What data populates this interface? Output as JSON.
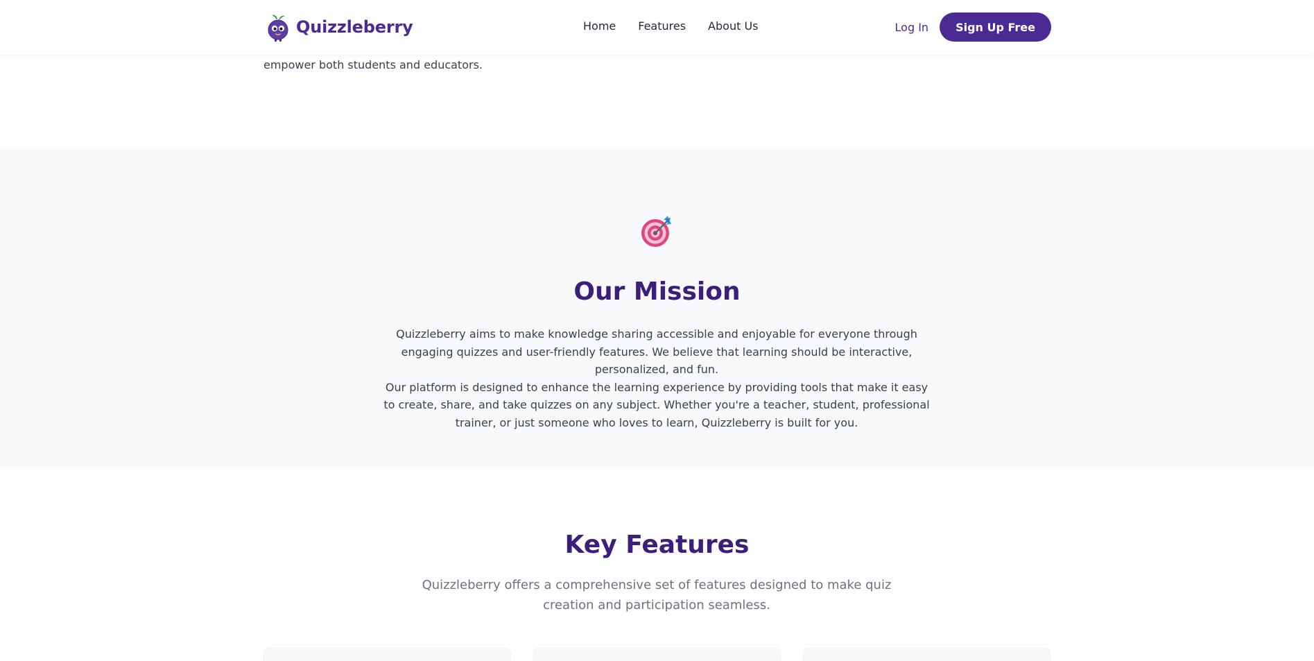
{
  "header": {
    "brand_name": "Quizzleberry",
    "nav": [
      "Home",
      "Features",
      "About Us"
    ],
    "login_label": "Log In",
    "signup_label": "Sign Up Free"
  },
  "intro": {
    "tail_line": "empower both students and educators."
  },
  "mission": {
    "icon": "target-dart-icon",
    "title": "Our Mission",
    "paragraph_1": "Quizzleberry aims to make knowledge sharing accessible and enjoyable for everyone through engaging quizzes and user-friendly features. We believe that learning should be interactive, personalized, and fun.",
    "paragraph_2": "Our platform is designed to enhance the learning experience by providing tools that make it easy to create, share, and take quizzes on any subject. Whether you're a teacher, student, professional trainer, or just someone who loves to learn, Quizzleberry is built for you."
  },
  "features": {
    "title": "Key Features",
    "subtitle": "Quizzleberry offers a comprehensive set of features designed to make quiz creation and participation seamless."
  },
  "colors": {
    "brand": "#4c2a93",
    "heading": "#3b1f7a",
    "section_bg": "#f8f9fb"
  }
}
